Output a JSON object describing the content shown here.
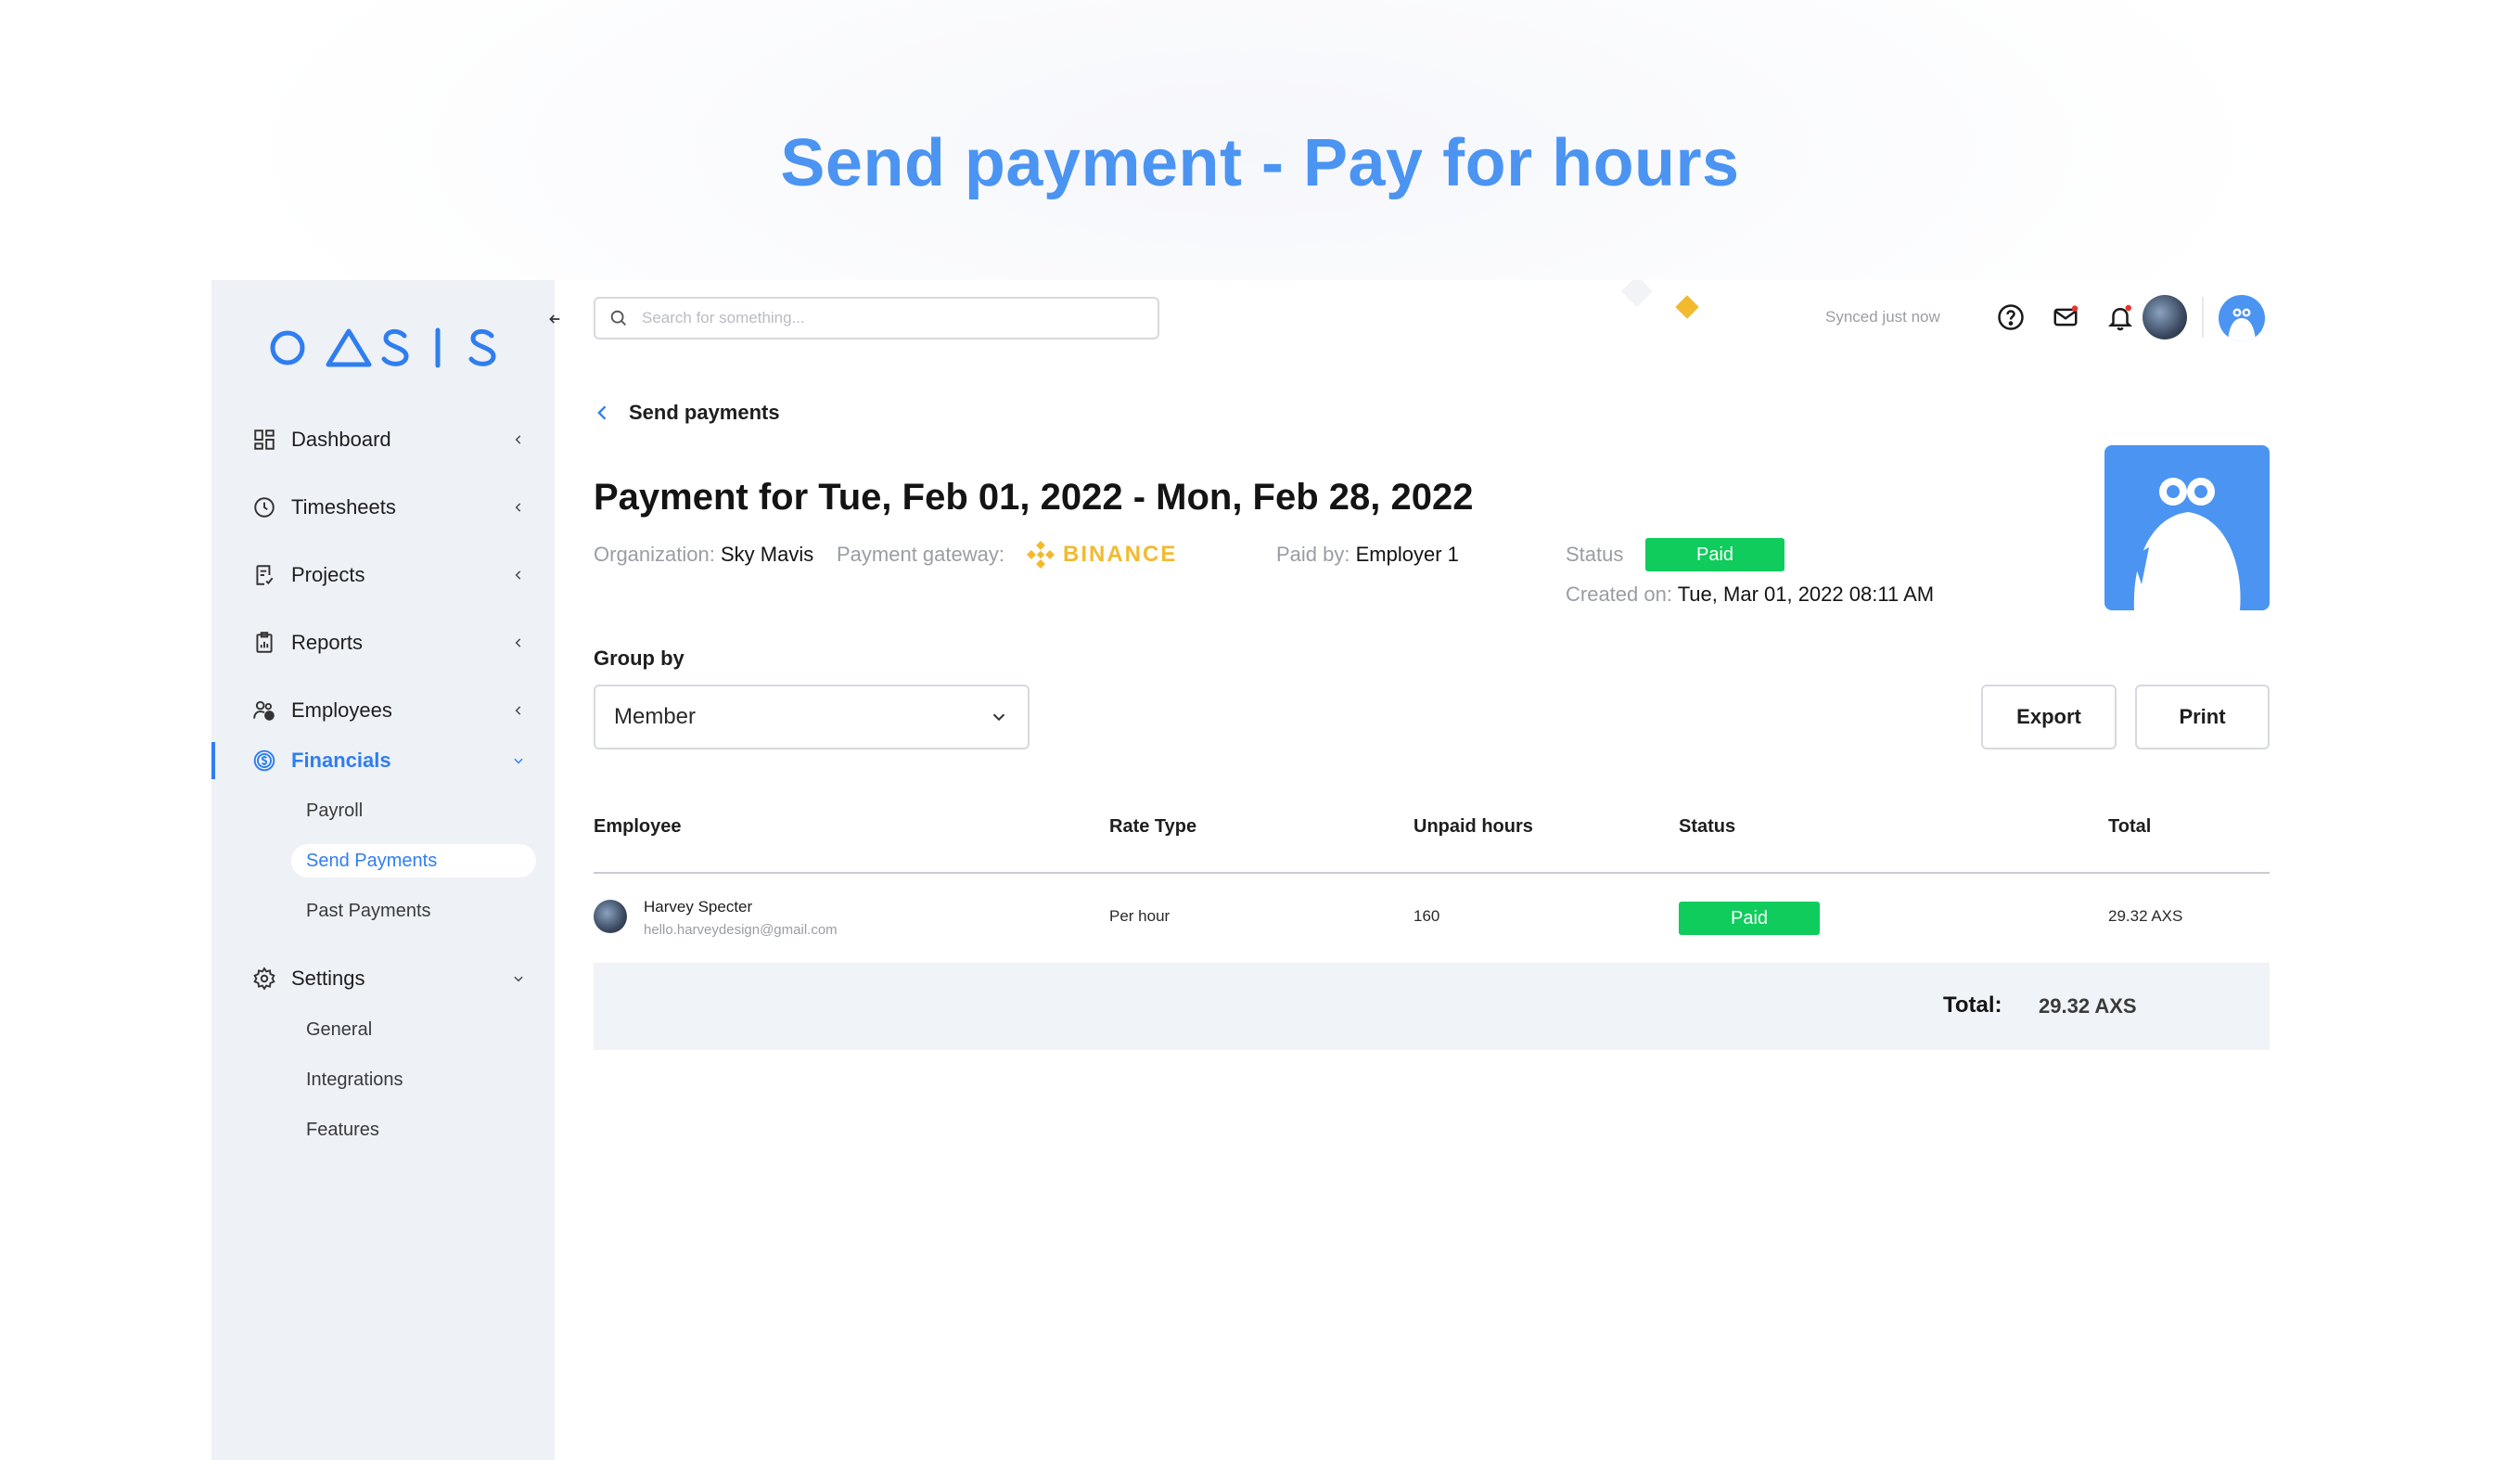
{
  "page_heading": "Send payment - Pay for hours",
  "brand": {
    "logo_text": "OASIS",
    "accent": "#2f7ef0"
  },
  "sidebar": {
    "items": [
      {
        "label": "Dashboard",
        "icon": "grid-icon"
      },
      {
        "label": "Timesheets",
        "icon": "clock-icon"
      },
      {
        "label": "Projects",
        "icon": "file-check-icon"
      },
      {
        "label": "Reports",
        "icon": "clipboard-icon"
      },
      {
        "label": "Employees",
        "icon": "users-icon"
      },
      {
        "label": "Financials",
        "icon": "dollar-circle-icon",
        "active": true
      },
      {
        "label": "Settings",
        "icon": "gear-icon"
      }
    ],
    "financials_sub": [
      "Payroll",
      "Send Payments",
      "Past Payments"
    ],
    "settings_sub": [
      "General",
      "Integrations",
      "Features"
    ]
  },
  "topbar": {
    "search_placeholder": "Search for something...",
    "sync_status": "Synced just now"
  },
  "breadcrumb": {
    "back_label": "Send payments"
  },
  "payment": {
    "title": "Payment for Tue, Feb 01, 2022 - Mon, Feb 28, 2022",
    "org_label": "Organization:",
    "org_value": "Sky Mavis",
    "gateway_label": "Payment gateway:",
    "gateway_value": "BINANCE",
    "paid_by_label": "Paid by:",
    "paid_by_value": "Employer 1",
    "status_label": "Status",
    "status_value": "Paid",
    "created_label": "Created on:",
    "created_value": "Tue, Mar 01, 2022 08:11 AM"
  },
  "controls": {
    "group_by_label": "Group by",
    "group_by_value": "Member",
    "export_label": "Export",
    "print_label": "Print"
  },
  "table": {
    "headers": {
      "employee": "Employee",
      "rate_type": "Rate Type",
      "unpaid_hours": "Unpaid hours",
      "status": "Status",
      "total": "Total"
    },
    "rows": [
      {
        "name": "Harvey Specter",
        "email": "hello.harveydesign@gmail.com",
        "rate_type": "Per hour",
        "unpaid_hours": "160",
        "status": "Paid",
        "total": "29.32 AXS"
      }
    ],
    "footer_label": "Total:",
    "footer_value": "29.32 AXS"
  },
  "colors": {
    "heading": "#4b94f2",
    "paid_green": "#0fcc5c",
    "binance_yellow": "#f3ba2f",
    "sidebar_bg": "#eef1f6"
  }
}
